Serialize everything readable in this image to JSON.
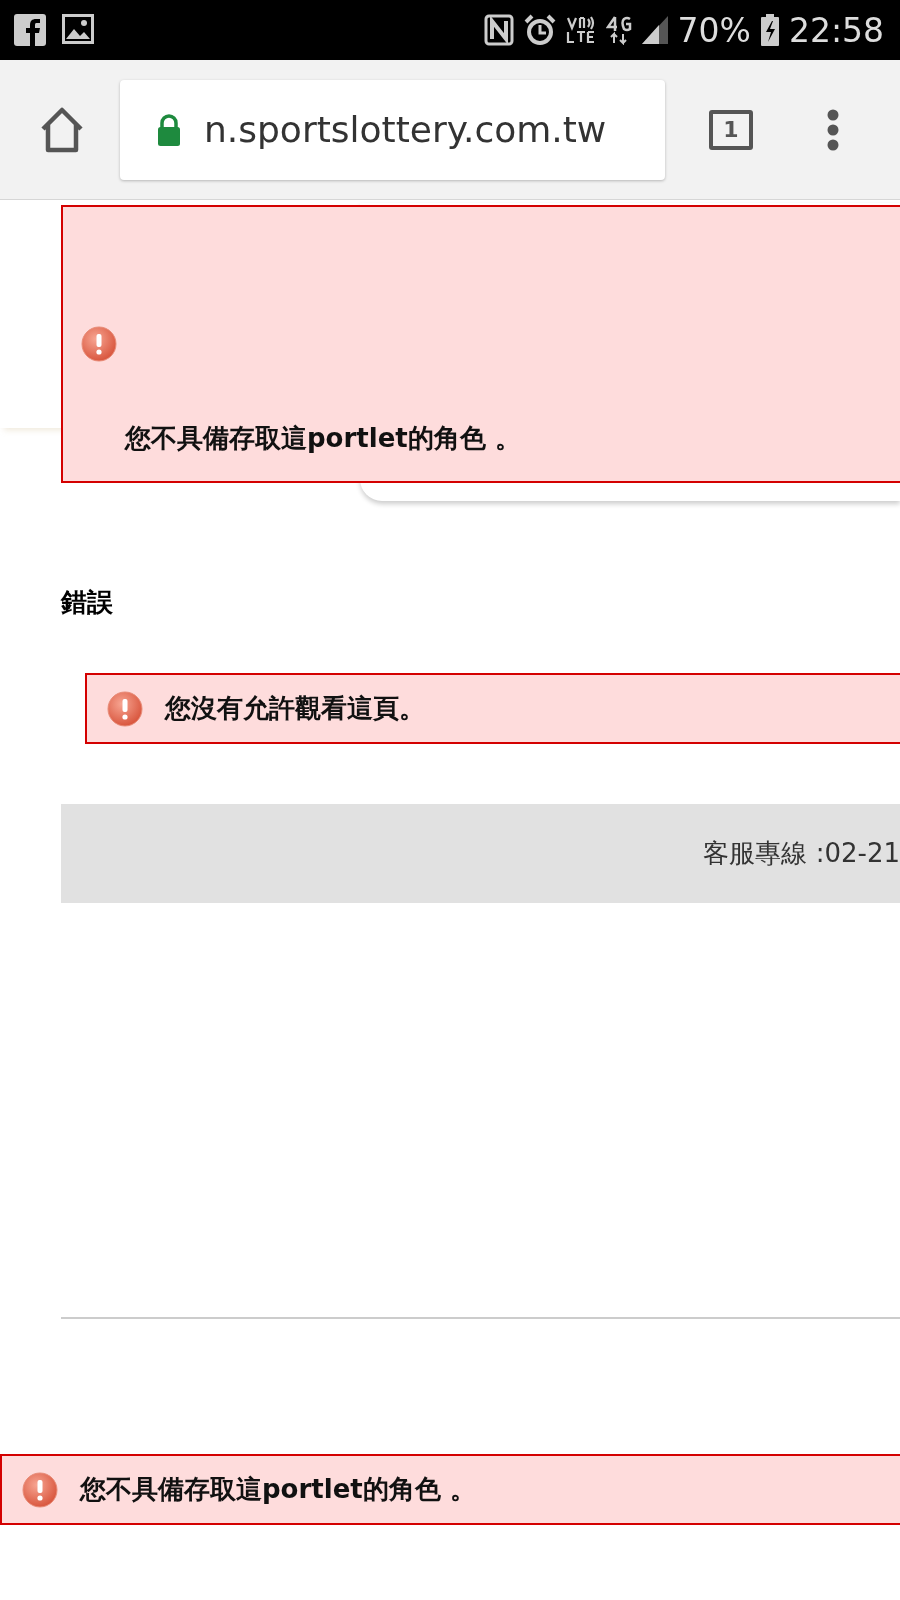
{
  "status_bar": {
    "battery": "70%",
    "time": "22:58"
  },
  "address_bar": {
    "url": "n.sportslottery.com.tw",
    "secure": true,
    "tab_count": "1"
  },
  "portlet_error": {
    "text": "您不具備存取這portlet的角色 。"
  },
  "heading": "錯誤",
  "page_error": {
    "text": "您沒有允許觀看這頁。"
  },
  "footer": {
    "text": "客服專線 :02-21"
  },
  "bottom_error": {
    "text": "您不具備存取這portlet的角色 。"
  }
}
